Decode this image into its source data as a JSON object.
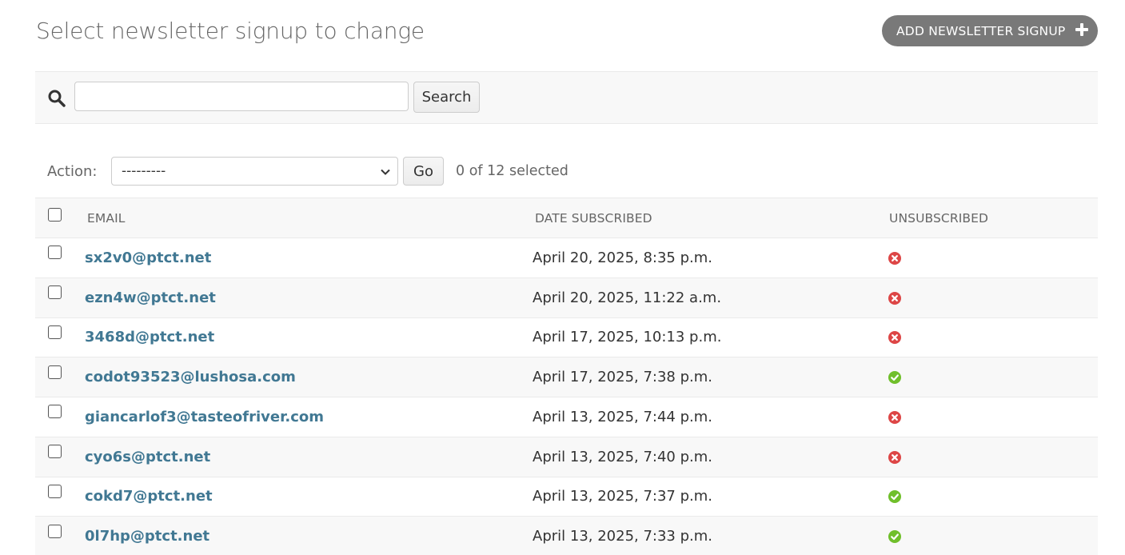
{
  "page": {
    "title": "Select newsletter signup to change"
  },
  "header": {
    "add_label": "ADD NEWSLETTER SIGNUP"
  },
  "search": {
    "value": "",
    "placeholder": "",
    "button_label": "Search"
  },
  "actions": {
    "label": "Action:",
    "selected_value": "---------",
    "go_label": "Go",
    "counter": "0 of 12 selected"
  },
  "table": {
    "columns": [
      "EMAIL",
      "DATE SUBSCRIBED",
      "UNSUBSCRIBED"
    ],
    "rows": [
      {
        "email": "sx2v0@ptct.net",
        "date": "April 20, 2025, 8:35 p.m.",
        "unsubscribed": false
      },
      {
        "email": "ezn4w@ptct.net",
        "date": "April 20, 2025, 11:22 a.m.",
        "unsubscribed": false
      },
      {
        "email": "3468d@ptct.net",
        "date": "April 17, 2025, 10:13 p.m.",
        "unsubscribed": false
      },
      {
        "email": "codot93523@lushosa.com",
        "date": "April 17, 2025, 7:38 p.m.",
        "unsubscribed": true
      },
      {
        "email": "giancarlof3@tasteofriver.com",
        "date": "April 13, 2025, 7:44 p.m.",
        "unsubscribed": false
      },
      {
        "email": "cyo6s@ptct.net",
        "date": "April 13, 2025, 7:40 p.m.",
        "unsubscribed": false
      },
      {
        "email": "cokd7@ptct.net",
        "date": "April 13, 2025, 7:37 p.m.",
        "unsubscribed": true
      },
      {
        "email": "0l7hp@ptct.net",
        "date": "April 13, 2025, 7:33 p.m.",
        "unsubscribed": true
      }
    ]
  },
  "colors": {
    "link": "#417893",
    "yes": "#70bf2b",
    "no": "#dd4646",
    "button": "#797979"
  },
  "icons": {
    "yes": "check-circle-icon",
    "no": "x-circle-icon"
  }
}
